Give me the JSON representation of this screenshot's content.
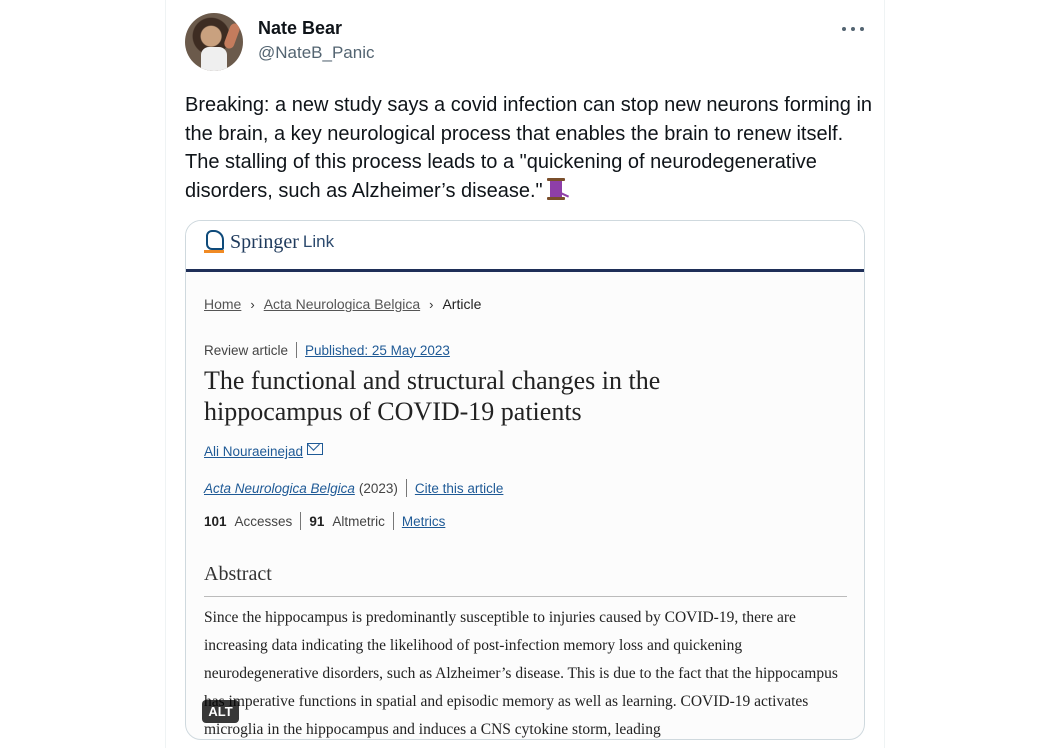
{
  "tweet": {
    "author_name": "Nate Bear",
    "author_handle": "@NateB_Panic",
    "text": "Breaking: a new study says a covid infection can stop new neurons forming in the brain, a key neurological process that enables the brain to renew itself. The stalling of this process leads to a \"quickening of neurodegenerative disorders, such as Alzheimer’s disease.\"",
    "emoji_icon": "thread-spool-icon"
  },
  "media": {
    "alt_badge": "ALT",
    "site": {
      "brand": "Springer",
      "brand_suffix": "Link",
      "accent": "#1f2f58"
    },
    "breadcrumb": [
      "Home",
      "Acta Neurologica Belgica",
      "Article"
    ],
    "article_type": "Review article",
    "published": "Published: 25 May 2023",
    "title": "The functional and structural changes in the hippocampus of COVID-19 patients",
    "author": "Ali Nouraeinejad",
    "journal": "Acta Neurologica Belgica",
    "year": "(2023)",
    "cite_link": "Cite this article",
    "metrics": {
      "accesses_value": "101",
      "accesses_label": "Accesses",
      "altmetric_value": "91",
      "altmetric_label": "Altmetric",
      "metrics_link": "Metrics"
    },
    "abstract_heading": "Abstract",
    "abstract_text": "Since the hippocampus is predominantly susceptible to injuries caused by COVID-19, there are increasing data indicating the likelihood of post-infection memory loss and quickening neurodegenerative disorders, such as Alzheimer’s disease. This is due to the fact that the hippocampus has imperative functions in spatial and episodic memory as well as learning. COVID-19 activates microglia in the hippocampus and induces a CNS cytokine storm, leading"
  }
}
